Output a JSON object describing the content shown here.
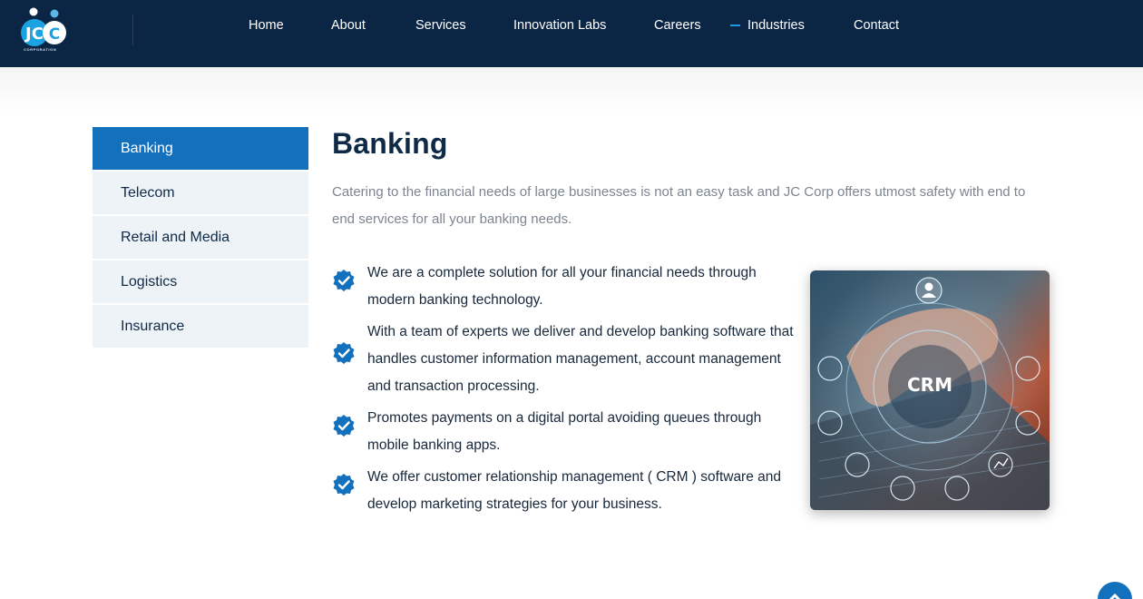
{
  "brand": {
    "logo_text": "JC",
    "logo_subtext": "CORPORATION"
  },
  "nav": {
    "items": [
      {
        "label": "Home"
      },
      {
        "label": "About"
      },
      {
        "label": "Services"
      },
      {
        "label": "Innovation Labs"
      },
      {
        "label": "Careers"
      },
      {
        "label": "Industries",
        "active": true
      },
      {
        "label": "Contact"
      }
    ]
  },
  "sidebar": {
    "items": [
      {
        "label": "Banking",
        "active": true
      },
      {
        "label": "Telecom"
      },
      {
        "label": "Retail and Media"
      },
      {
        "label": "Logistics"
      },
      {
        "label": "Insurance"
      }
    ]
  },
  "main": {
    "title": "Banking",
    "intro": "Catering to the financial needs of large businesses is not an easy task and JC Corp offers utmost safety with end to end services for all your banking needs.",
    "bullets": [
      {
        "text": "We are a complete solution for all your financial needs through modern banking technology."
      },
      {
        "text": "With a team of experts we deliver and develop banking software that handles customer information management, account management and transaction processing."
      },
      {
        "text": "Promotes payments on a digital portal avoiding queues through mobile banking apps."
      },
      {
        "text": "We offer customer relationship management ( CRM ) software and develop marketing strategies for your business."
      }
    ],
    "image_label": "CRM"
  },
  "colors": {
    "header_bg": "#0b2545",
    "accent": "#1370bd",
    "sidebar_bg": "#eef3f8",
    "heading": "#0e2a47",
    "muted_text": "#7c8590"
  },
  "icons": {
    "bullet": "verified-check-icon",
    "scroll_top": "chevron-up-icon"
  }
}
